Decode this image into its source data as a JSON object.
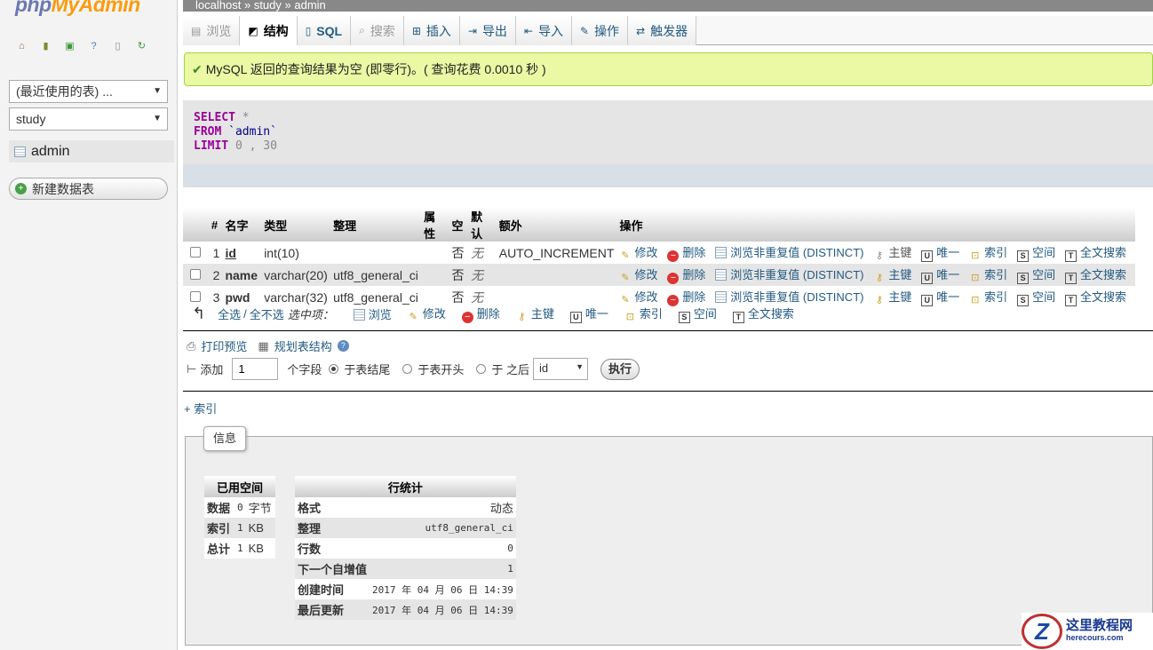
{
  "logo": {
    "part1": "php",
    "part2": "MyAdmin"
  },
  "sidebar": {
    "recent_select": "(最近使用的表) ...",
    "db_select": "study",
    "table_item": "admin",
    "new_table_btn": "新建数据表"
  },
  "breadcrumb": {
    "server": "localhost",
    "sep1": "»",
    "db": "study",
    "sep2": "»",
    "table": "admin"
  },
  "tabs": [
    {
      "label": "浏览",
      "icon": "browse-icon"
    },
    {
      "label": "结构",
      "icon": "structure-icon"
    },
    {
      "label": "SQL",
      "icon": "sql-icon"
    },
    {
      "label": "搜索",
      "icon": "search-icon"
    },
    {
      "label": "插入",
      "icon": "insert-icon"
    },
    {
      "label": "导出",
      "icon": "export-icon"
    },
    {
      "label": "导入",
      "icon": "import-icon"
    },
    {
      "label": "操作",
      "icon": "wrench-icon"
    },
    {
      "label": "触发器",
      "icon": "trigger-icon"
    }
  ],
  "message": "MySQL 返回的查询结果为空 (即零行)。( 查询花费 0.0010 秒 )",
  "sql": {
    "kw1": "SELECT",
    "star": "*",
    "kw2": "FROM",
    "table": "`admin`",
    "kw3": "LIMIT",
    "limit": "0 , 30"
  },
  "columns": {
    "num": "#",
    "name": "名字",
    "type": "类型",
    "collation": "整理",
    "attributes": "属性",
    "null": "空",
    "default": "默认",
    "extra": "额外",
    "action": "操作"
  },
  "rows": [
    {
      "num": "1",
      "name": "id",
      "type": "int(10)",
      "collation": "",
      "null": "否",
      "default": "无",
      "extra": "AUTO_INCREMENT"
    },
    {
      "num": "2",
      "name": "name",
      "type": "varchar(20)",
      "collation": "utf8_general_ci",
      "null": "否",
      "default": "无",
      "extra": ""
    },
    {
      "num": "3",
      "name": "pwd",
      "type": "varchar(32)",
      "collation": "utf8_general_ci",
      "null": "否",
      "default": "无",
      "extra": ""
    }
  ],
  "row_actions": {
    "edit": "修改",
    "delete": "删除",
    "distinct": "浏览非重复值 (DISTINCT)",
    "primary": "主键",
    "unique": "唯一",
    "index": "索引",
    "spatial": "空间",
    "fulltext": "全文搜索"
  },
  "bulk": {
    "check_all": "全选",
    "sep": "/",
    "uncheck_all": "全不选",
    "selected": "选中项：",
    "browse": "浏览",
    "edit": "修改",
    "delete": "删除",
    "primary": "主键",
    "unique": "唯一",
    "index": "索引",
    "spatial": "空间",
    "fulltext": "全文搜索"
  },
  "print": {
    "print_view": "打印预览",
    "propose": "规划表结构"
  },
  "add": {
    "label": "添加",
    "value": "1",
    "fields": "个字段",
    "at_end": "于表结尾",
    "at_begin": "于表开头",
    "after": "于 之后",
    "after_col": "id",
    "go": "执行"
  },
  "index_link": "+ 索引",
  "info": {
    "legend": "信息",
    "space": {
      "header": "已用空间",
      "rows": [
        {
          "k": "数据",
          "v": "0",
          "u": "字节"
        },
        {
          "k": "索引",
          "v": "1",
          "u": "KB"
        },
        {
          "k": "总计",
          "v": "1",
          "u": "KB"
        }
      ]
    },
    "stats": {
      "header": "行统计",
      "rows": [
        {
          "k": "格式",
          "v": "动态"
        },
        {
          "k": "整理",
          "v": "utf8_general_ci"
        },
        {
          "k": "行数",
          "v": "0"
        },
        {
          "k": "下一个自增值",
          "v": "1"
        },
        {
          "k": "创建时间",
          "v": "2017 年 04 月 06 日 14:39"
        },
        {
          "k": "最后更新",
          "v": "2017 年 04 月 06 日 14:39"
        }
      ]
    }
  },
  "watermark": {
    "title": "这里教程网",
    "url": "herecours.com"
  }
}
